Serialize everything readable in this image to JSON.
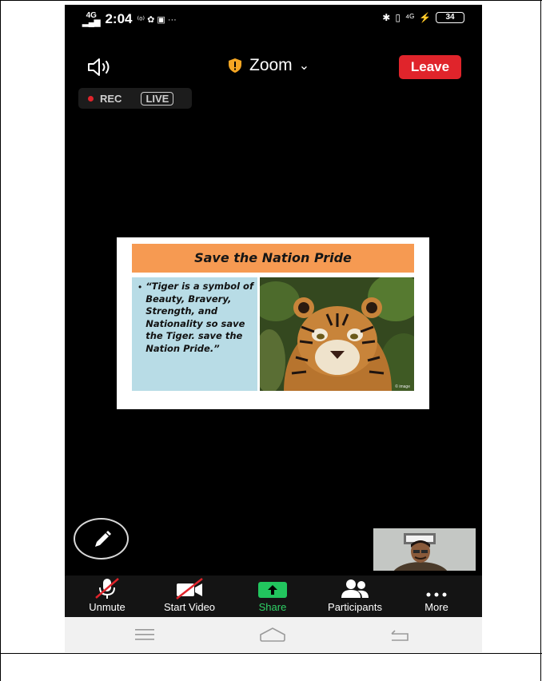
{
  "status_bar": {
    "network": "4G",
    "time": "2:04",
    "left_icons": "⁽ᵒ⁾ ✿ ▣ ···",
    "battery": "34"
  },
  "meeting": {
    "title": "Zoom",
    "leave_label": "Leave",
    "rec_label": "REC",
    "live_label": "LIVE"
  },
  "slide": {
    "title": "Save the Nation Pride",
    "quote": "“Tiger is a symbol of Beauty, Bravery, Strength, and Nationality so save the Tiger. save the Nation Pride.”",
    "bullet": "•"
  },
  "toolbar": {
    "unmute": "Unmute",
    "start_video": "Start Video",
    "share": "Share",
    "participants": "Participants",
    "more": "More"
  },
  "colors": {
    "leave": "#e0242b",
    "share": "#22c55e",
    "share_label": "#2fd166",
    "slide_title_bg": "#f69a52",
    "slide_text_bg": "#b8dce6",
    "shield": "#f5a623"
  }
}
